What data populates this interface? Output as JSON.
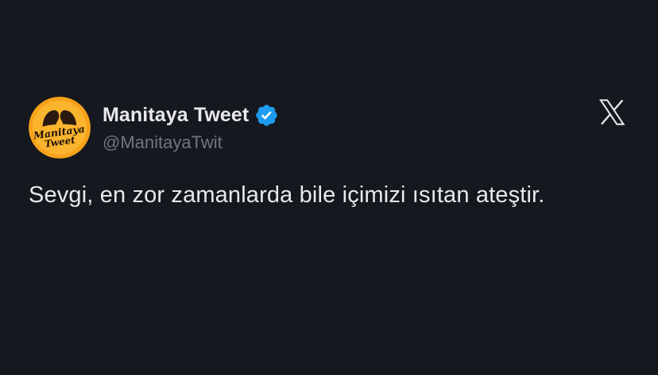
{
  "tweet": {
    "display_name": "Manitaya Tweet",
    "handle": "@ManitayaTwit",
    "text": "Sevgi, en zor zamanlarda bile içimizi ısıtan ateştir.",
    "verified": true
  },
  "avatar": {
    "logo_line1": "Manitaya",
    "logo_line2": "Tweet",
    "bg_color": "#f7a21b"
  },
  "icons": {
    "verified": "verified-badge-icon",
    "brand": "x-logo-icon"
  },
  "colors": {
    "background": "#16181f",
    "text": "#e7e9ea",
    "secondary_text": "#71767b",
    "verified_blue": "#1d9bf0"
  }
}
